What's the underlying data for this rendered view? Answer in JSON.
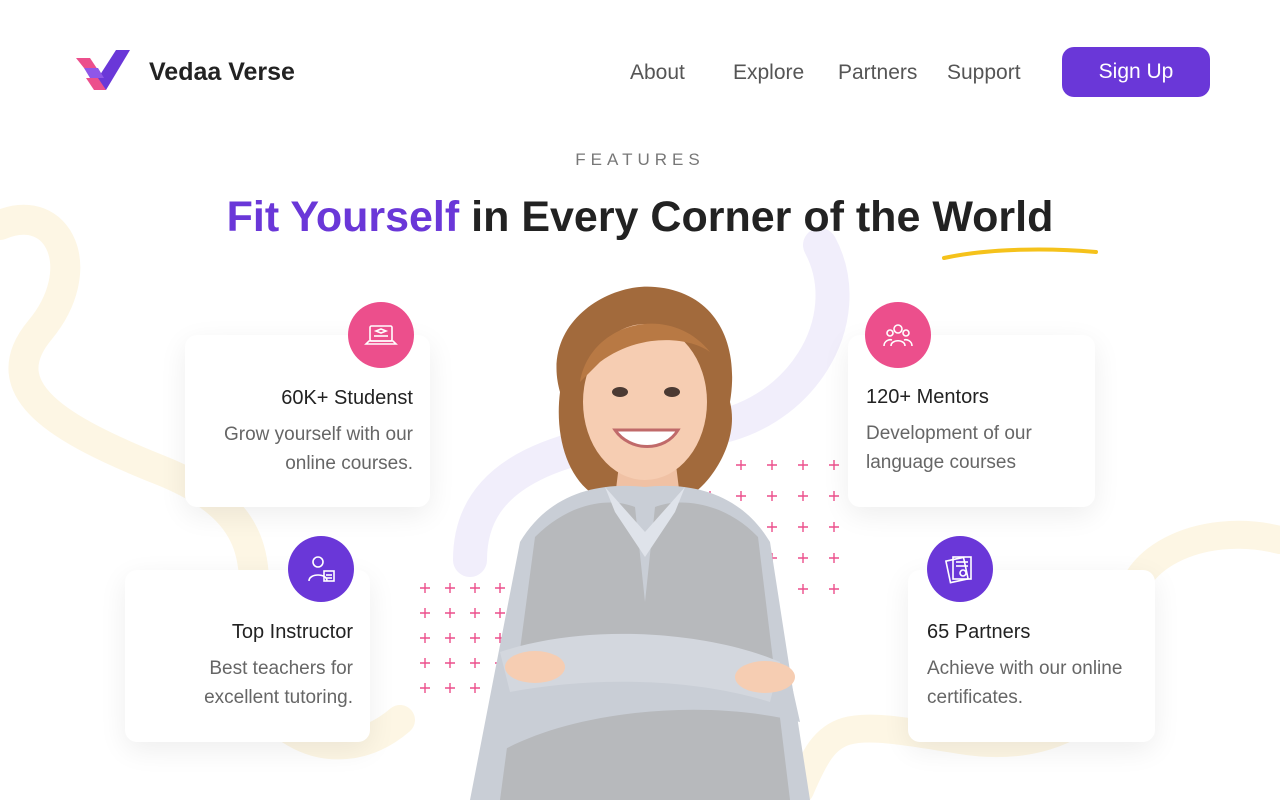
{
  "brand": {
    "name": "Vedaa Verse",
    "icon": "vv-logo-icon"
  },
  "nav": {
    "items": [
      {
        "label": "About"
      },
      {
        "label": "Explore"
      },
      {
        "label": "Partners"
      },
      {
        "label": "Support"
      }
    ],
    "signup_label": "Sign Up"
  },
  "hero": {
    "eyebrow": "FEATURES",
    "headline_accent": "Fit Yourself",
    "headline_rest": "in Every Corner of the World"
  },
  "features": [
    {
      "title": "60K+ Studenst",
      "desc": "Grow yourself with our online courses.",
      "icon": "laptop-course-icon"
    },
    {
      "title": "120+ Mentors",
      "desc": "Development of our language courses",
      "icon": "group-people-icon"
    },
    {
      "title": "Top Instructor",
      "desc": "Best teachers for excellent tutoring.",
      "icon": "instructor-icon"
    },
    {
      "title": "65 Partners",
      "desc": "Achieve with our online certificates.",
      "icon": "certificate-icon"
    }
  ],
  "colors": {
    "brand_purple": "#6a37d8",
    "accent_pink": "#ec4f8c",
    "underline_yellow": "#f5c21b"
  }
}
